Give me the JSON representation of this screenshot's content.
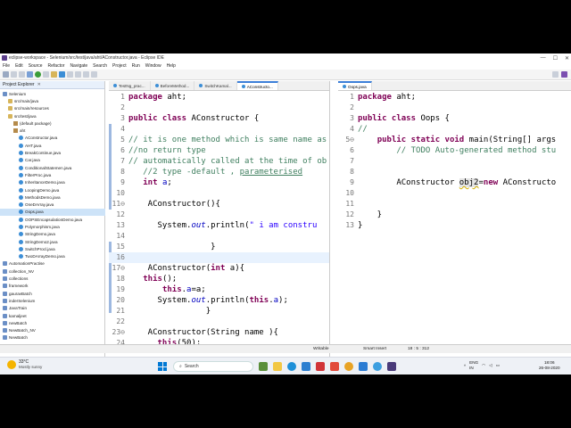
{
  "window": {
    "title": "eclipse-workspace - Selenium/src/test/java/aht/AConstructor.java - Eclipse IDE"
  },
  "menu": [
    "File",
    "Edit",
    "Source",
    "Refactor",
    "Navigate",
    "Search",
    "Project",
    "Run",
    "Window",
    "Help"
  ],
  "explorer": {
    "title": "Project Explorer",
    "items": [
      {
        "label": "Selenium",
        "type": "proj",
        "indent": 0
      },
      {
        "label": "src/main/java",
        "type": "folder",
        "indent": 1
      },
      {
        "label": "src/main/resources",
        "type": "folder",
        "indent": 1
      },
      {
        "label": "src/test/java",
        "type": "folder",
        "indent": 1
      },
      {
        "label": "(default package)",
        "type": "pkg",
        "indent": 2
      },
      {
        "label": "aht",
        "type": "pkg",
        "indent": 2
      },
      {
        "label": "AConstructor.java",
        "type": "java",
        "indent": 3
      },
      {
        "label": "AHT.java",
        "type": "java",
        "indent": 3
      },
      {
        "label": "BreakContinue.java",
        "type": "java",
        "indent": 3
      },
      {
        "label": "Car.java",
        "type": "java",
        "indent": 3
      },
      {
        "label": "ConditionalStatemen.java",
        "type": "java",
        "indent": 3
      },
      {
        "label": "FilterProc.java",
        "type": "java",
        "indent": 3
      },
      {
        "label": "InheritanceDemo.java",
        "type": "java",
        "indent": 3
      },
      {
        "label": "LoopingDemo.java",
        "type": "java",
        "indent": 3
      },
      {
        "label": "MethodsDemo.java",
        "type": "java",
        "indent": 3
      },
      {
        "label": "OneDArray.java",
        "type": "java",
        "indent": 3
      },
      {
        "label": "Oops.java",
        "type": "java",
        "indent": 3,
        "selected": true
      },
      {
        "label": "OOPSEncapsulationDemo.java",
        "type": "java",
        "indent": 3
      },
      {
        "label": "Polymorphism.java",
        "type": "java",
        "indent": 3
      },
      {
        "label": "StringDemo.java",
        "type": "java",
        "indent": 3
      },
      {
        "label": "StringDemo2.java",
        "type": "java",
        "indent": 3
      },
      {
        "label": "SwitchProcl.java",
        "type": "java",
        "indent": 3
      },
      {
        "label": "TwoDArrayDemo.java",
        "type": "java",
        "indent": 3
      },
      {
        "label": "AutomationPractise",
        "type": "proj",
        "indent": 0
      },
      {
        "label": "collection_NV",
        "type": "proj",
        "indent": 0
      },
      {
        "label": "collections",
        "type": "proj",
        "indent": 0
      },
      {
        "label": "framework",
        "type": "proj",
        "indent": 0
      },
      {
        "label": "gauravBatch",
        "type": "proj",
        "indent": 0
      },
      {
        "label": "inderSelenium",
        "type": "proj",
        "indent": 0
      },
      {
        "label": "JavaTrain",
        "type": "proj",
        "indent": 0
      },
      {
        "label": "kamaljeet",
        "type": "proj",
        "indent": 0
      },
      {
        "label": "newBatch",
        "type": "proj",
        "indent": 0
      },
      {
        "label": "NewBatch_NV",
        "type": "proj",
        "indent": 0
      },
      {
        "label": "NewBatch",
        "type": "proj",
        "indent": 0
      }
    ]
  },
  "editor1": {
    "tabs": [
      "TestNg_prac...",
      "BeforeMethod...",
      "SwitchKamal...",
      "AConstructo..."
    ],
    "active_tab": 3
  },
  "editor2": {
    "tabs": [
      "Oops.java"
    ],
    "active_tab": 0
  },
  "status": {
    "writable": "Writable",
    "insert": "Smart Insert",
    "position": "18 : 5 : 312"
  },
  "taskbar": {
    "temp": "33°C",
    "weather": "Mostly sunny",
    "search": "Search",
    "lang1": "ENG",
    "lang2": "IN",
    "time": "18:06",
    "date": "26-08-2020"
  },
  "colors": {
    "accent": "#3c7fd8",
    "keyword": "#7f0055",
    "comment": "#3f7f5f",
    "string": "#2a00ff"
  }
}
